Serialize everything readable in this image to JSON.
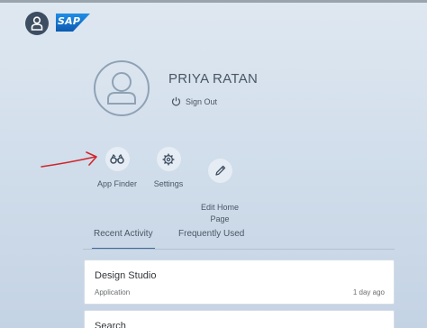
{
  "header": {
    "user_icon": "person-icon",
    "logo_text": "SAP"
  },
  "profile": {
    "avatar_icon": "person-icon",
    "name": "PRIYA RATAN",
    "sign_out_label": "Sign Out",
    "sign_out_icon": "power-icon"
  },
  "actions": [
    {
      "label": "App Finder",
      "icon": "binoculars-icon"
    },
    {
      "label": "Settings",
      "icon": "gear-icon"
    },
    {
      "label": "Edit Home\nPage",
      "icon": "pencil-icon"
    }
  ],
  "tabs": [
    {
      "label": "Recent Activity",
      "active": true
    },
    {
      "label": "Frequently Used",
      "active": false
    }
  ],
  "recent_items": [
    {
      "title": "Design Studio",
      "type": "Application",
      "time": "1 day ago"
    },
    {
      "title": "Search",
      "type": "",
      "time": ""
    }
  ],
  "colors": {
    "accent": "#3f6b9c",
    "logo_blue": "#1c7ad1",
    "annotation_red": "#d0262b",
    "avatar_dark": "#3e4e62"
  }
}
